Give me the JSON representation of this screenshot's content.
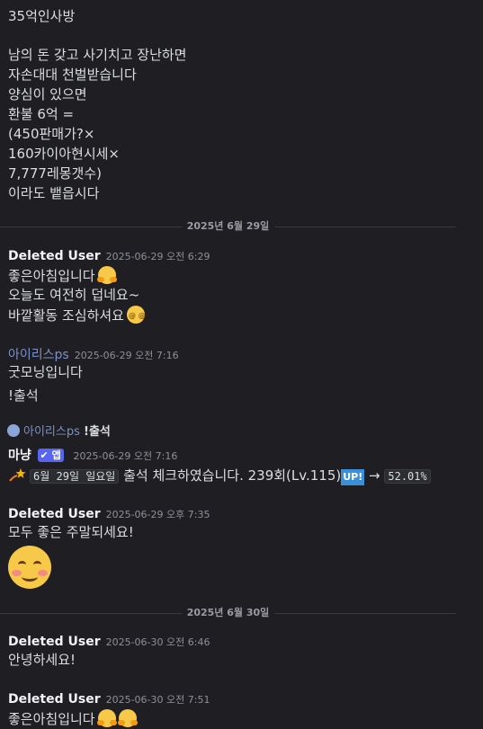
{
  "top_message": {
    "lines": [
      "35억인사방",
      "",
      "남의 돈 갖고 사기치고 장난하면",
      "자손대대 천벌받습니다",
      "양심이 있으면",
      "환불 6억 =",
      "(450판매가?×",
      "160카이아현시세×",
      "7,777레몽갯수)",
      "이라도 뱉읍시다"
    ]
  },
  "divider_1": "2025년 6월 29일",
  "msg_1": {
    "user": "Deleted User",
    "time": "2025-06-29 오전 6:29",
    "line1": "좋은아침입니다",
    "line2": "오늘도 여전히 덥네요~",
    "line3": "바깥활동 조심하셔요"
  },
  "msg_2": {
    "user": "아이리스ps",
    "time": "2025-06-29 오전 7:16",
    "line1": "굿모닝입니다",
    "line2": "!출석"
  },
  "reply_ref": {
    "user": "아이리스ps",
    "text": "!출석"
  },
  "msg_3": {
    "user": "마냥",
    "badge": "✔ 앱",
    "time": "2025-06-29 오전 7:16",
    "date_code": "6월 29일 일요일",
    "text": "출석 체크하였습니다. 239회(Lv.115)",
    "up": "UP!",
    "arrow": "→",
    "percent": "52.01%"
  },
  "msg_4": {
    "user": "Deleted User",
    "time": "2025-06-29 오후 7:35",
    "line1": "모두 좋은 주말되세요!"
  },
  "divider_2": "2025년 6월 30일",
  "msg_5": {
    "user": "Deleted User",
    "time": "2025-06-30 오전 6:46",
    "line1": "안녕하세요!"
  },
  "msg_6": {
    "user": "Deleted User",
    "time": "2025-06-30 오전 7:51",
    "line1": "좋은아침입니다"
  }
}
